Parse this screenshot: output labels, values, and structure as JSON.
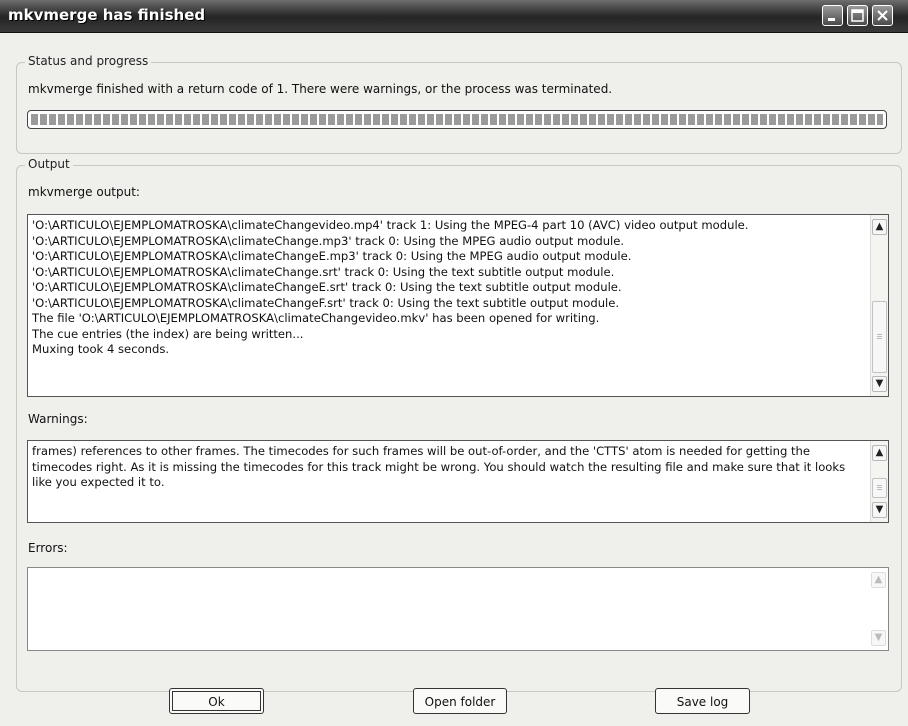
{
  "window": {
    "title": "mkvmerge has finished"
  },
  "status": {
    "group_label": "Status and progress",
    "message": "mkvmerge finished with a return code of 1. There were warnings, or the process was terminated.",
    "progress_fraction": 1.0
  },
  "output": {
    "group_label": "Output",
    "mkvmerge_output_label": "mkvmerge output:",
    "mkvmerge_output_text": "'O:\\ARTICULO\\EJEMPLOMATROSKA\\climateChangevideo.mp4' track 1: Using the MPEG-4 part 10 (AVC) video output module.\n'O:\\ARTICULO\\EJEMPLOMATROSKA\\climateChange.mp3' track 0: Using the MPEG audio output module.\n'O:\\ARTICULO\\EJEMPLOMATROSKA\\climateChangeE.mp3' track 0: Using the MPEG audio output module.\n'O:\\ARTICULO\\EJEMPLOMATROSKA\\climateChange.srt' track 0: Using the text subtitle output module.\n'O:\\ARTICULO\\EJEMPLOMATROSKA\\climateChangeE.srt' track 0: Using the text subtitle output module.\n'O:\\ARTICULO\\EJEMPLOMATROSKA\\climateChangeF.srt' track 0: Using the text subtitle output module.\nThe file 'O:\\ARTICULO\\EJEMPLOMATROSKA\\climateChangevideo.mkv' has been opened for writing.\nThe cue entries (the index) are being written...\nMuxing took 4 seconds.",
    "warnings_label": "Warnings:",
    "warnings_text": "frames) references to other frames. The timecodes for such frames will be out-of-order, and the 'CTTS' atom is needed for getting the timecodes right. As it is missing the timecodes for this track might be wrong. You should watch the resulting file and make sure that it looks like you expected it to.",
    "errors_label": "Errors:",
    "errors_text": ""
  },
  "buttons": {
    "ok": "Ok",
    "open_folder": "Open folder",
    "save_log": "Save log"
  },
  "icons": {
    "minimize": "minimize-icon",
    "maximize": "maximize-icon",
    "close": "close-icon"
  }
}
